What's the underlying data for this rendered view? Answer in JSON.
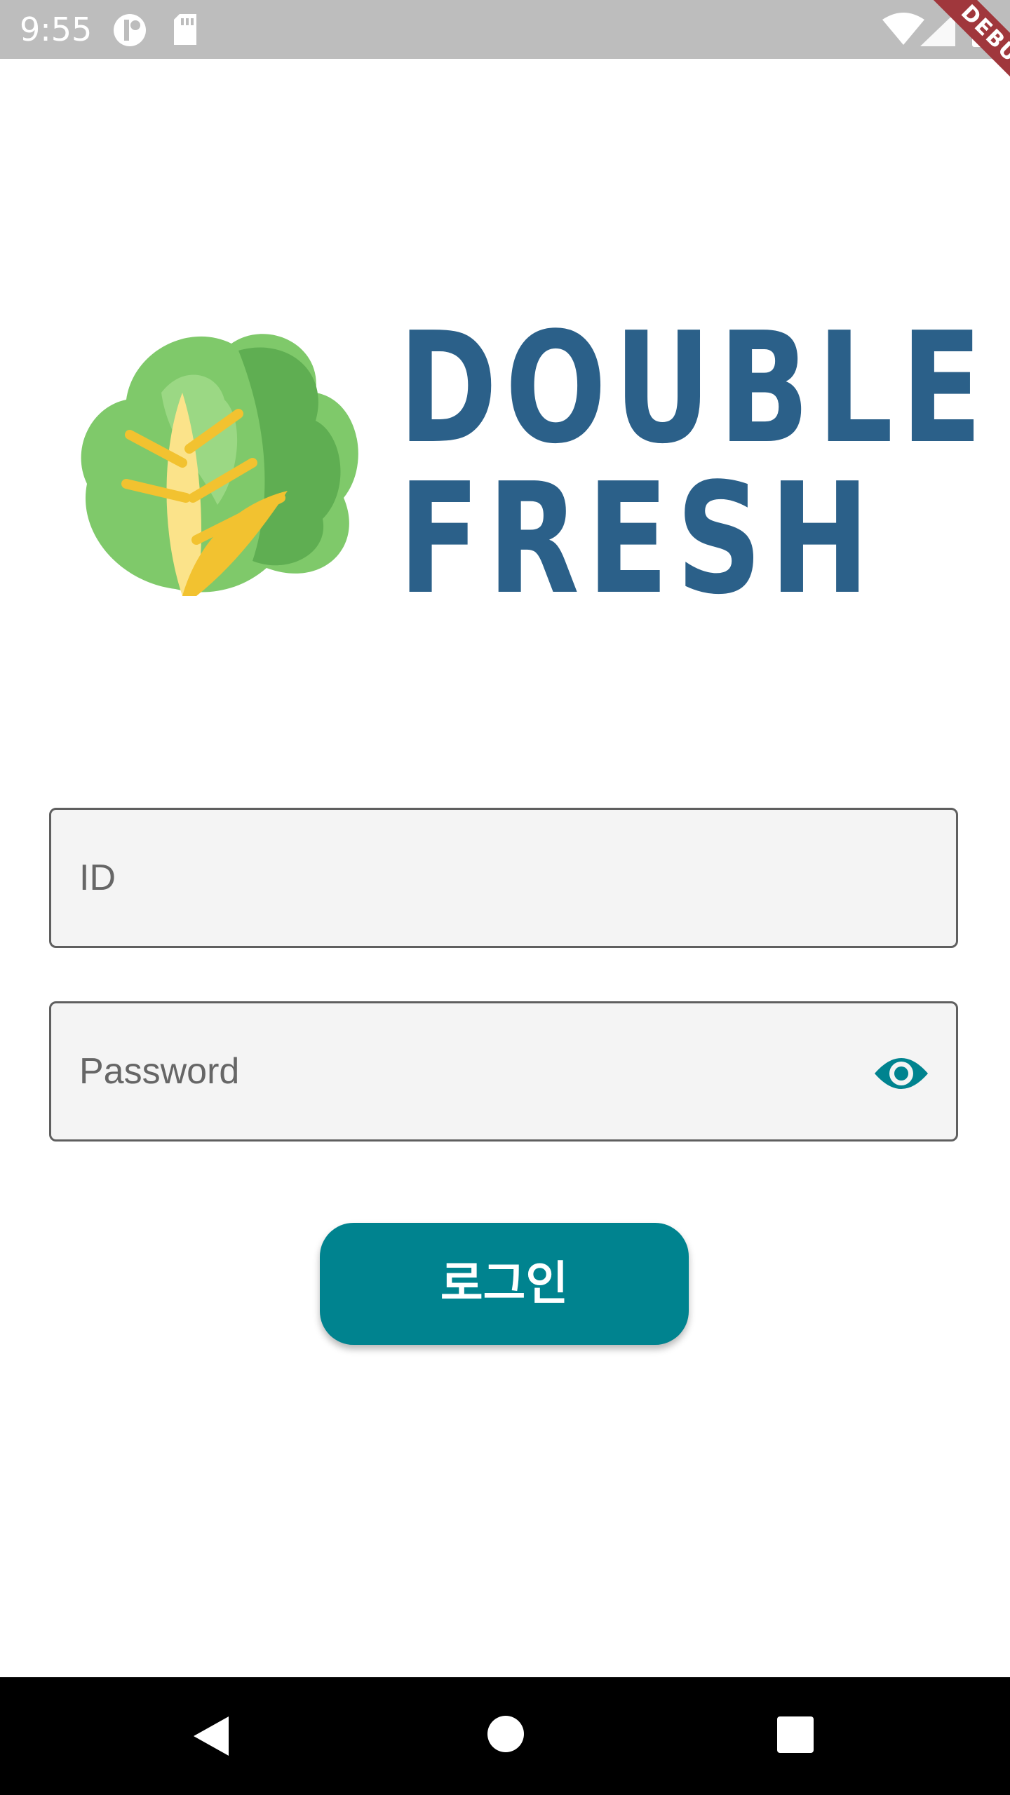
{
  "status_bar": {
    "time": "9:55",
    "icons": [
      "notification-icon",
      "sd-card-icon",
      "wifi-icon",
      "signal-icon",
      "battery-icon"
    ],
    "debug_label": "DEBUG",
    "background": "#bdbdbd"
  },
  "logo": {
    "icon": "lettuce-icon",
    "line1": "DOUBLE",
    "line2": "FRESH",
    "brand_color": "#2b6089"
  },
  "form": {
    "id_placeholder": "ID",
    "password_placeholder": "Password",
    "password_toggle_icon": "eye-icon",
    "login_label": "로그인",
    "accent_color": "#00838f"
  },
  "nav_bar": {
    "buttons": [
      "back-icon",
      "home-icon",
      "recents-icon"
    ]
  }
}
